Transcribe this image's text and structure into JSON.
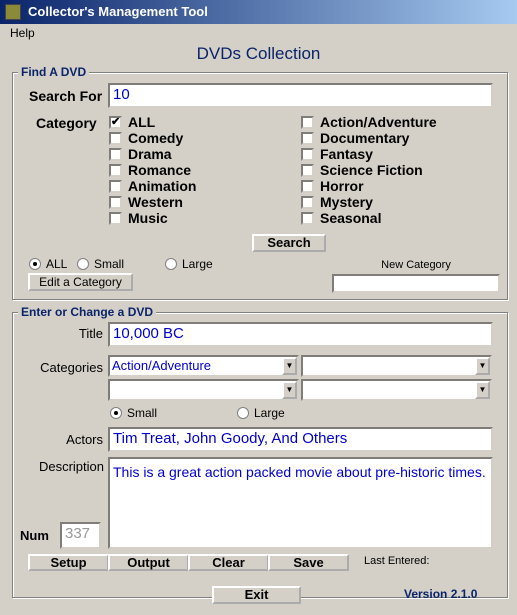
{
  "window": {
    "title": "Collector's Management Tool"
  },
  "menu": {
    "help": "Help"
  },
  "heading": "DVDs Collection",
  "find": {
    "group_label": "Find A DVD",
    "search_label": "Search For",
    "search_value": "10",
    "category_label": "Category",
    "categories_left": [
      {
        "label": "ALL",
        "checked": true
      },
      {
        "label": "Comedy",
        "checked": false
      },
      {
        "label": "Drama",
        "checked": false
      },
      {
        "label": "Romance",
        "checked": false
      },
      {
        "label": "Animation",
        "checked": false
      },
      {
        "label": "Western",
        "checked": false
      },
      {
        "label": "Music",
        "checked": false
      }
    ],
    "categories_right": [
      {
        "label": "Action/Adventure",
        "checked": false
      },
      {
        "label": "Documentary",
        "checked": false
      },
      {
        "label": "Fantasy",
        "checked": false
      },
      {
        "label": "Science Fiction",
        "checked": false
      },
      {
        "label": "Horror",
        "checked": false
      },
      {
        "label": "Mystery",
        "checked": false
      },
      {
        "label": "Seasonal",
        "checked": false
      }
    ],
    "search_button": "Search",
    "size_options": [
      {
        "label": "ALL",
        "selected": true
      },
      {
        "label": "Small",
        "selected": false
      },
      {
        "label": "Large",
        "selected": false
      }
    ],
    "edit_category_button": "Edit a Category",
    "new_category_label": "New Category",
    "new_category_value": ""
  },
  "entry": {
    "group_label": "Enter or Change a DVD",
    "title_label": "Title",
    "title_value": "10,000 BC",
    "categories_label": "Categories",
    "category_selects": [
      "Action/Adventure",
      "",
      "",
      ""
    ],
    "size_options": [
      {
        "label": "Small",
        "selected": true
      },
      {
        "label": "Large",
        "selected": false
      }
    ],
    "actors_label": "Actors",
    "actors_value": "Tim Treat, John Goody, And Others",
    "description_label": "Description",
    "description_value": "This is a great action packed movie about pre-historic times.",
    "num_label": "Num",
    "num_value": "337",
    "buttons": [
      "Setup",
      "Output",
      "Clear",
      "Save"
    ],
    "last_entered_label": "Last Entered:"
  },
  "exit_button": "Exit",
  "version": "Version 2.1.0"
}
